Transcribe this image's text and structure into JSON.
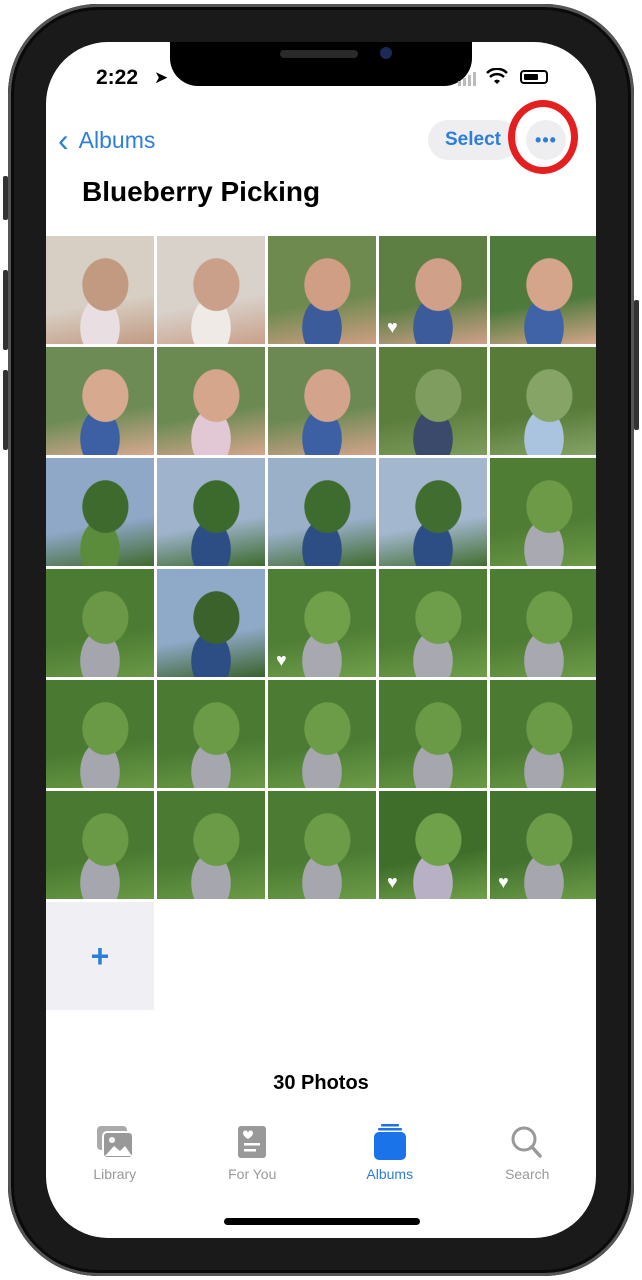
{
  "status_bar": {
    "time": "2:22",
    "location_icon": "location-arrow-icon",
    "wifi_icon": "wifi-icon",
    "battery_icon": "battery-icon"
  },
  "nav": {
    "back_label": "Albums",
    "select_label": "Select",
    "more_label": "•••"
  },
  "album": {
    "title": "Blueberry Picking",
    "count_label": "30 Photos"
  },
  "photos": [
    {
      "desc": "baby lying on couch",
      "favorite": false,
      "colors": [
        "#d8cfc4",
        "#c29a82",
        "#e9dfe2"
      ]
    },
    {
      "desc": "baby lying on couch close",
      "favorite": false,
      "colors": [
        "#d9d2cb",
        "#caa08a",
        "#efeae6"
      ]
    },
    {
      "desc": "family selfie",
      "favorite": false,
      "colors": [
        "#6f8a4f",
        "#cf9e84",
        "#3c5b9a"
      ]
    },
    {
      "desc": "family selfie",
      "favorite": true,
      "colors": [
        "#5d7f44",
        "#d0a089",
        "#3c5b9a"
      ]
    },
    {
      "desc": "family selfie",
      "favorite": false,
      "colors": [
        "#4e7a3c",
        "#d4a58a",
        "#4063a8"
      ]
    },
    {
      "desc": "group selfie with grandparents",
      "favorite": false,
      "colors": [
        "#6d8b55",
        "#d7a98f",
        "#3d5fa4"
      ]
    },
    {
      "desc": "group selfie with grandparents",
      "favorite": false,
      "colors": [
        "#6a8a52",
        "#d6a68c",
        "#e2c7d5"
      ]
    },
    {
      "desc": "group selfie with grandparents",
      "favorite": false,
      "colors": [
        "#6c8953",
        "#d3a48b",
        "#3d5fa4"
      ]
    },
    {
      "desc": "blueberry bush closeup",
      "favorite": false,
      "colors": [
        "#5c7e3c",
        "#7f9d5e",
        "#3b4a6a"
      ]
    },
    {
      "desc": "blueberry bush closeup",
      "favorite": false,
      "colors": [
        "#587b39",
        "#85a466",
        "#aac4e0"
      ]
    },
    {
      "desc": "orchard rows under sky",
      "favorite": false,
      "colors": [
        "#8fa8c8",
        "#3f6a2e",
        "#5b8c3b"
      ]
    },
    {
      "desc": "woman in orchard",
      "favorite": false,
      "colors": [
        "#9fb4cc",
        "#3c6a2c",
        "#2d4e84"
      ]
    },
    {
      "desc": "woman in orchard",
      "favorite": false,
      "colors": [
        "#9ab0c9",
        "#3e6b2e",
        "#2d4e84"
      ]
    },
    {
      "desc": "woman in orchard",
      "favorite": false,
      "colors": [
        "#a3b7cf",
        "#416e30",
        "#2d4e84"
      ]
    },
    {
      "desc": "woman holding baby",
      "favorite": false,
      "colors": [
        "#4f7d34",
        "#6c9a47",
        "#a9a9b2"
      ]
    },
    {
      "desc": "woman holding baby",
      "favorite": false,
      "colors": [
        "#4c7c33",
        "#6a9846",
        "#a5a5ae"
      ]
    },
    {
      "desc": "woman among bushes",
      "favorite": false,
      "colors": [
        "#8fa9c8",
        "#3a622a",
        "#2d4e84"
      ]
    },
    {
      "desc": "woman holding baby with berries",
      "favorite": true,
      "colors": [
        "#4f7e35",
        "#70a04a",
        "#a8a8b0"
      ]
    },
    {
      "desc": "woman holding baby with berries",
      "favorite": false,
      "colors": [
        "#4e7d34",
        "#6e9e49",
        "#a8a8b0"
      ]
    },
    {
      "desc": "woman holding baby with berries",
      "favorite": false,
      "colors": [
        "#4d7c33",
        "#6d9d48",
        "#a8a8b0"
      ]
    },
    {
      "desc": "woman holding baby",
      "favorite": false,
      "colors": [
        "#4a7a31",
        "#6a9a45",
        "#a6a6ae"
      ]
    },
    {
      "desc": "woman holding baby",
      "favorite": false,
      "colors": [
        "#4b7b32",
        "#6b9b46",
        "#a6a6ae"
      ]
    },
    {
      "desc": "woman holding baby",
      "favorite": false,
      "colors": [
        "#4c7c33",
        "#6c9c47",
        "#a6a6ae"
      ]
    },
    {
      "desc": "woman holding baby",
      "favorite": false,
      "colors": [
        "#4a7a31",
        "#6a9a45",
        "#a6a6ae"
      ]
    },
    {
      "desc": "woman holding baby",
      "favorite": false,
      "colors": [
        "#4b7b32",
        "#6b9b46",
        "#a6a6ae"
      ]
    },
    {
      "desc": "woman holding baby",
      "favorite": false,
      "colors": [
        "#4a7a31",
        "#6a9a45",
        "#a6a6ae"
      ]
    },
    {
      "desc": "woman holding baby",
      "favorite": false,
      "colors": [
        "#4b7b32",
        "#6b9b46",
        "#a6a6ae"
      ]
    },
    {
      "desc": "woman holding baby",
      "favorite": false,
      "colors": [
        "#4c7c33",
        "#6c9c47",
        "#a6a6ae"
      ]
    },
    {
      "desc": "woman reaching in bushes",
      "favorite": true,
      "colors": [
        "#3f6e2a",
        "#6fa04a",
        "#b8b0c4"
      ]
    },
    {
      "desc": "woman holding baby in bushes",
      "favorite": true,
      "colors": [
        "#447330",
        "#6c9c47",
        "#a6a6ae"
      ]
    }
  ],
  "add_tile": {
    "label": "+"
  },
  "tabbar": [
    {
      "label": "Library",
      "icon": "photo-library-icon",
      "active": false
    },
    {
      "label": "For You",
      "icon": "for-you-icon",
      "active": false
    },
    {
      "label": "Albums",
      "icon": "albums-icon",
      "active": true
    },
    {
      "label": "Search",
      "icon": "search-icon",
      "active": false
    }
  ],
  "colors": {
    "accent": "#2c7fd9",
    "highlight_ring": "#e41f1f",
    "inactive": "#999999"
  }
}
